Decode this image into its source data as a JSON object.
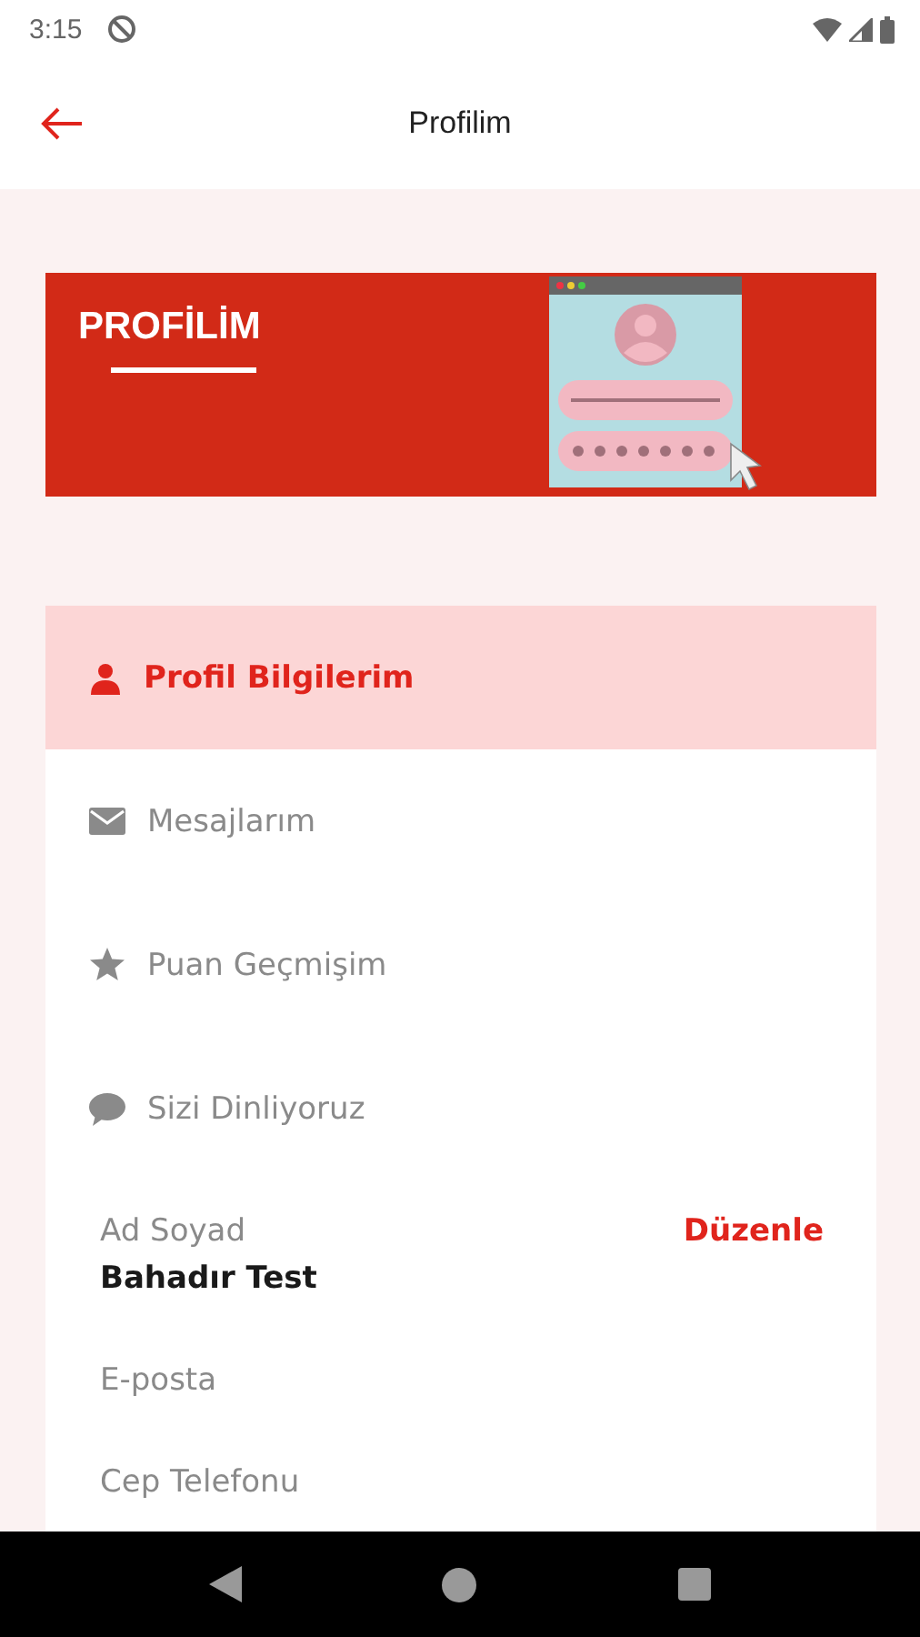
{
  "status_bar": {
    "time": "3:15"
  },
  "app_bar": {
    "title": "Profilim"
  },
  "banner": {
    "title": "PROFİLİM"
  },
  "menu": [
    {
      "label": "Profil Bilgilerim",
      "selected": true
    },
    {
      "label": "Mesajlarım",
      "selected": false
    },
    {
      "label": "Puan Geçmişim",
      "selected": false
    },
    {
      "label": "Sizi Dinliyoruz",
      "selected": false
    }
  ],
  "details": {
    "action": "Düzenle",
    "fields": [
      {
        "label": "Ad Soyad",
        "value": "Bahadır Test"
      },
      {
        "label": "E-posta"
      },
      {
        "label": "Cep Telefonu"
      }
    ]
  }
}
